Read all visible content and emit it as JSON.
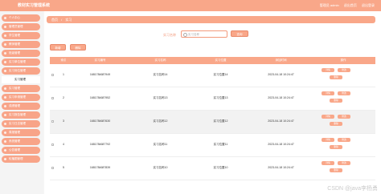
{
  "app": {
    "title": "教材实习管理系统"
  },
  "top_right": {
    "user": "管理员 admin",
    "home": "退出首页",
    "logout": "退出登录"
  },
  "sidebar": {
    "items": [
      "个人中心",
      "管理员管理",
      "学生管理",
      "教师管理",
      "班级管理",
      "实习单位管理",
      "实习岗位管理",
      "实习管理",
      "实习申请管理",
      "成绩管理",
      "实习报告管理",
      "实习日志管理",
      "周报管理",
      "系统管理",
      "公告管理",
      "轮播图管理"
    ],
    "active_sub": "实习管理"
  },
  "breadcrumb": {
    "home": "首页",
    "sep": "/",
    "current": "实习"
  },
  "search": {
    "label": "实习名称",
    "placeholder": "实习名称",
    "button": "查询"
  },
  "toolbar": {
    "add": "新增",
    "delete": "删除"
  },
  "table": {
    "headers": [
      "",
      "索引",
      "实习编号",
      "实习名称",
      "实习位置",
      "添加时间",
      "操作"
    ],
    "rows": [
      {
        "index": "1",
        "code": "1681784687949",
        "name": "实习名称14",
        "location": "实习位置14",
        "time": "2023-04-18 10:24:47"
      },
      {
        "index": "2",
        "code": "1681784687952",
        "name": "实习名称13",
        "location": "实习位置13",
        "time": "2023-04-18 10:24:47"
      },
      {
        "index": "3",
        "code": "1681784687630",
        "name": "实习名称12",
        "location": "实习位置12",
        "time": "2023-04-18 10:24:47"
      },
      {
        "index": "4",
        "code": "1681784687792",
        "name": "实习名称11",
        "location": "实习位置11",
        "time": "2023-04-18 10:24:47"
      },
      {
        "index": "5",
        "code": "1681784687839",
        "name": "实习名称10",
        "location": "实习位置10",
        "time": "2023-04-18 10:24:47"
      }
    ],
    "actions": {
      "detail": "详情",
      "edit": "修改",
      "delete": "删除"
    }
  },
  "watermark": "CSDN @java李杨勇"
}
